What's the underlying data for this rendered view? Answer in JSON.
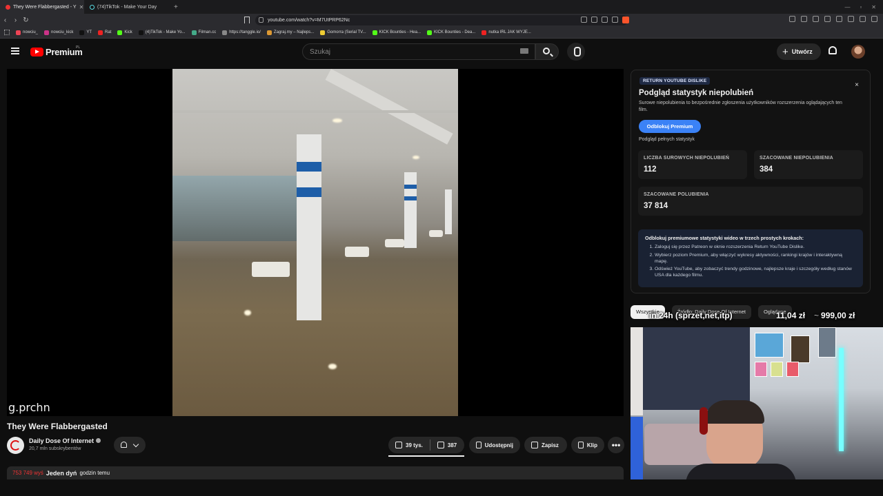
{
  "browser": {
    "tabs": [
      {
        "title": "They Were Flabbergasted - Y",
        "active": true
      },
      {
        "title": "(74)TikTok - Make Your Day",
        "active": false
      }
    ],
    "url": "youtube.com/watch?v=M7UtPRP62Nc",
    "bookmarks": [
      "nowciu_",
      "nowciu_kick",
      "YT",
      "Rat",
      "Kick",
      "(4)TikTok - Make Yo...",
      "Filman.cc",
      "https://tanggle.io/",
      "Zagraj.my – Najleps...",
      "Gomorra (Serial TV...",
      "KICK Bounties - Hea...",
      "KICK Bounties - Dea...",
      "nutka IRL JAK WYJE..."
    ]
  },
  "yt": {
    "logo_text": "Premium",
    "country": "PL",
    "search_placeholder": "Szukaj",
    "create_label": "Utwórz"
  },
  "video": {
    "watermark": "g.prchn",
    "title": "They Were Flabbergasted",
    "channel": "Daily Dose Of Internet",
    "subscribers": "20,7 mln subskrybentów",
    "likes": "39 tys.",
    "dislikes": "387",
    "share_label": "Udostępnij",
    "save_label": "Zapisz",
    "clip_label": "Klip",
    "more_label": "•••",
    "desc_views": "753 749 wyś",
    "desc_overlay": "Jeden dyń",
    "desc_time": "godzin temu"
  },
  "dislike_panel": {
    "badge": "RETURN YOUTUBE DISLIKE",
    "heading": "Podgląd statystyk niepolubień",
    "sub": "Surowe niepolubienia to bezpośrednie zgłoszenia użytkowników rozszerzenia oglądających ten film.",
    "unlock_label": "Odblokuj Premium",
    "preview_label": "Podgląd pełnych statystyk",
    "close": "×",
    "stats": [
      {
        "label": "LICZBA SUROWYCH NIEPOLUBIEŃ",
        "value": "112"
      },
      {
        "label": "SZACOWANE NIEPOLUBIENIA",
        "value": "384"
      },
      {
        "label": "SZACOWANE POLUBIENIA",
        "value": "37 814"
      }
    ],
    "steps_title": "Odblokuj premiumowe statystyki wideo w trzech prostych krokach:",
    "steps": [
      "Zaloguj się przez Patreon w oknie rozszerzenia Return YouTube Dislike.",
      "Wybierz poziom Premium, aby włączyć wykresy aktywności, rankingi krajów i interaktywną mapę.",
      "Odśwież YouTube, aby zobaczyć trendy godzinowe, najlepsze kraje i szczegóły według stanów USA dla każdego filmu."
    ]
  },
  "chips": [
    "Wszystkie",
    "Źródło: Daily Dose Of Internet",
    "Oglądane"
  ],
  "overlay": {
    "left": "in 24h (sprzet,net,itp)",
    "mid": "11,04 zł",
    "tilde": "~",
    "right": "999,00 zł"
  },
  "colors": {
    "accent": "#3b82f6",
    "yt_red": "#ff0000",
    "bg": "#0f0f0f"
  }
}
